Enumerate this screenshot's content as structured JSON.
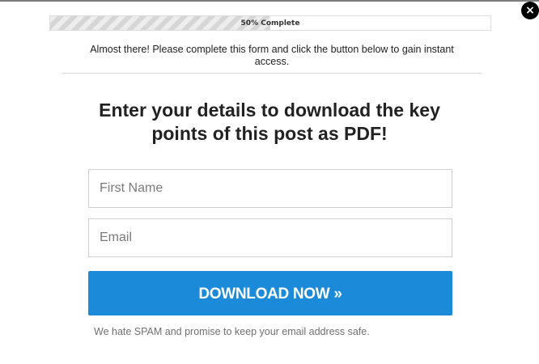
{
  "close_button": {
    "label": "×",
    "icon": "close-icon"
  },
  "progress": {
    "percent": 50,
    "label": "50% Complete"
  },
  "intro_text": "Almost there! Please complete this form and click the button below to gain instant access.",
  "headline": "Enter your details to download the key points of this post as PDF!",
  "form": {
    "first_name_placeholder": "First Name",
    "email_placeholder": "Email",
    "submit_label": "DOWNLOAD NOW »"
  },
  "privacy_note": "We hate SPAM and promise to keep your email address safe.",
  "colors": {
    "button": "#1a8ad9",
    "close_bg": "#000000",
    "progress_stripe": "#d6d6d6"
  }
}
